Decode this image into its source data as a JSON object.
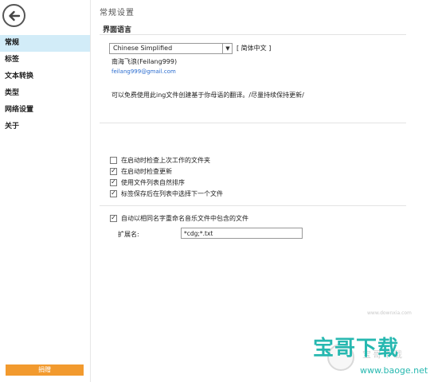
{
  "sidebar": {
    "items": [
      {
        "label": "常规"
      },
      {
        "label": "标签"
      },
      {
        "label": "文本转换"
      },
      {
        "label": "类型"
      },
      {
        "label": "网络设置"
      },
      {
        "label": "关于"
      }
    ],
    "donate_label": "捐赠"
  },
  "main": {
    "page_title": "常规设置",
    "interface_language": {
      "section_title": "界面语言",
      "selected_language": "Chinese Simplified",
      "native_name": "[ 简体中文 ]",
      "translator": "南海飞浪(Feilang999)",
      "email": "feilang999@gmail.com",
      "translate_note": "可以免费使用此ing文件创建基于你母语的翻译。/尽量持续保持更新/"
    },
    "options": [
      {
        "label": "在启动时检查上次工作的文件夹",
        "checked": false
      },
      {
        "label": "在启动时检查更新",
        "checked": true
      },
      {
        "label": "使用文件列表自然排序",
        "checked": true
      },
      {
        "label": "标签保存后在列表中选择下一个文件",
        "checked": true
      }
    ],
    "auto_rename": {
      "label": "自动以相同名字重命名音乐文件中包含的文件",
      "checked": true
    },
    "extensions": {
      "label": "扩展名:",
      "value": "*cdg;*.txt"
    }
  },
  "watermark": {
    "brand": "宝哥下载",
    "url": "www.baoge.net",
    "faint": "宝哥下载",
    "faint_small": "www.downxia.com",
    "color": "#27b8b0"
  }
}
